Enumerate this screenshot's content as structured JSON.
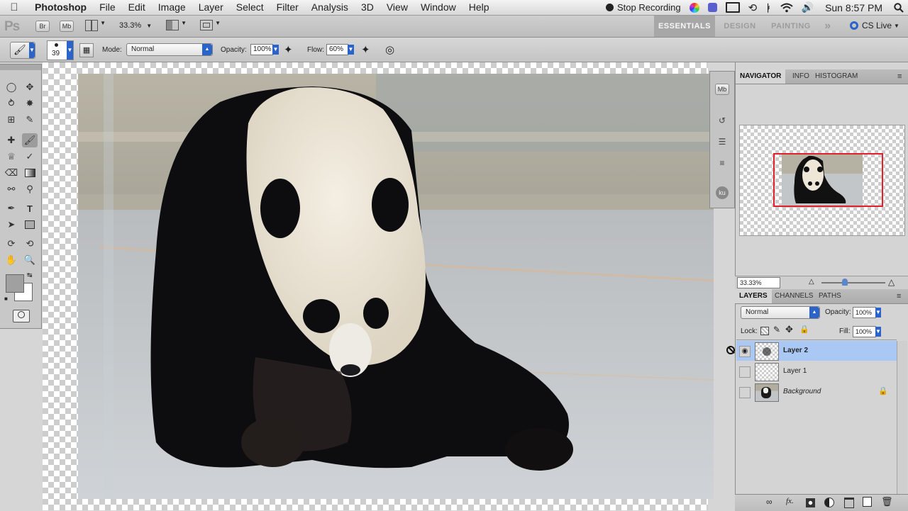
{
  "menubar": {
    "app": "Photoshop",
    "items": [
      "File",
      "Edit",
      "Image",
      "Layer",
      "Select",
      "Filter",
      "Analysis",
      "3D",
      "View",
      "Window",
      "Help"
    ],
    "stop_recording": "Stop Recording",
    "clock": "Sun 8:57 PM"
  },
  "appbar": {
    "logo": "Ps",
    "bridge": "Br",
    "minibridge": "Mb",
    "zoom": "33.3%",
    "workspaces": [
      "ESSENTIALS",
      "DESIGN",
      "PAINTING"
    ],
    "more": "»",
    "cslive": "CS Live"
  },
  "options": {
    "brush_size": "39",
    "mode_label": "Mode:",
    "mode_value": "Normal",
    "opacity_label": "Opacity:",
    "opacity_value": "100%",
    "flow_label": "Flow:",
    "flow_value": "60%"
  },
  "dock": {
    "mb": "Mb",
    "ku": "ku"
  },
  "navigator": {
    "tabs": [
      "NAVIGATOR",
      "INFO",
      "HISTOGRAM"
    ],
    "zoom": "33.33%"
  },
  "layers_panel": {
    "tabs": [
      "LAYERS",
      "CHANNELS",
      "PATHS"
    ],
    "blend_mode": "Normal",
    "opacity_label": "Opacity:",
    "opacity_value": "100%",
    "lock_label": "Lock:",
    "fill_label": "Fill:",
    "fill_value": "100%",
    "layers": [
      {
        "name": "Layer 2",
        "selected": true,
        "visible": true
      },
      {
        "name": "Layer 1",
        "selected": false,
        "visible": false
      },
      {
        "name": "Background",
        "selected": false,
        "visible": false,
        "locked": true
      }
    ]
  },
  "colors": {
    "accent": "#2a63c9",
    "layer_selected": "#a9c8f3",
    "nav_box": "#e0202c"
  }
}
